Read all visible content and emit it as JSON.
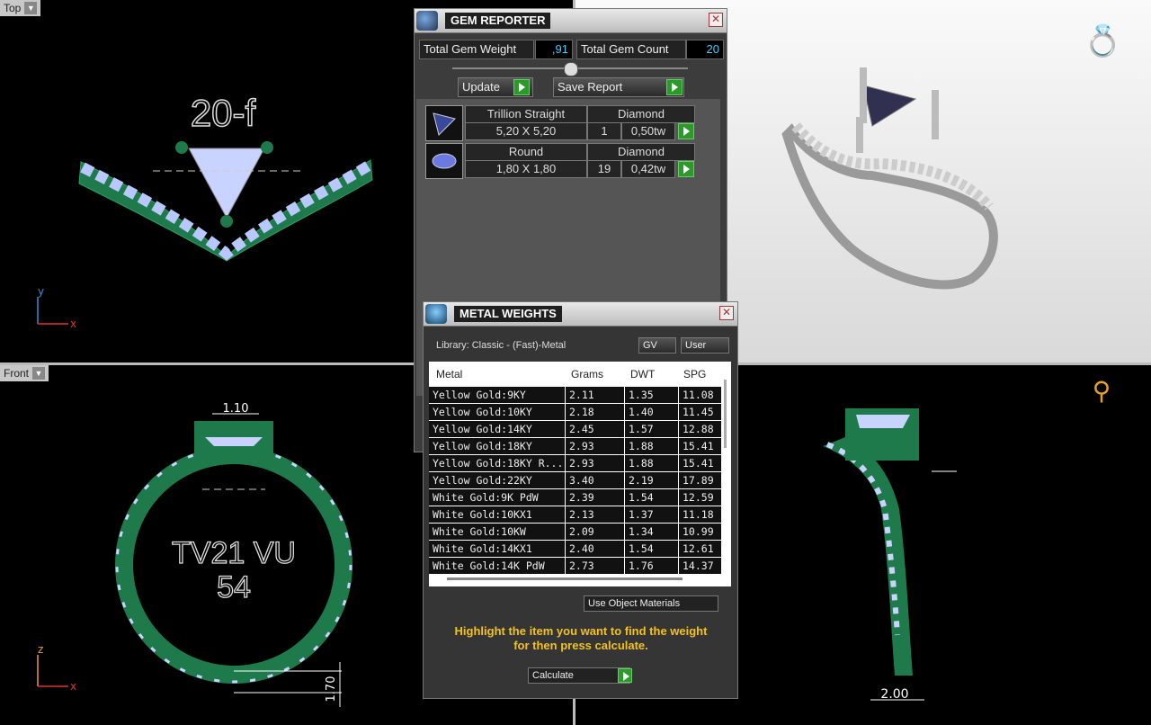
{
  "viewports": {
    "top_left": {
      "label": "Top",
      "model_text": "20-f",
      "axis_y": "y",
      "axis_x": "x"
    },
    "bottom_left": {
      "label": "Front",
      "model_text_line1": "TV21 VU",
      "model_text_line2": "54",
      "dim_top": "1.10",
      "dim_side": "1.70",
      "axis_z": "z",
      "axis_x": "x"
    },
    "bottom_right": {
      "dim_bottom": "2.00"
    }
  },
  "gem_reporter": {
    "title": "GEM REPORTER",
    "total_weight_label": "Total Gem Weight",
    "total_weight_value": ",91",
    "total_count_label": "Total Gem Count",
    "total_count_value": "20",
    "update_label": "Update",
    "save_report_label": "Save Report",
    "gems": [
      {
        "shape": "Trillion Straight",
        "material": "Diamond",
        "size": "5,20 X 5,20",
        "count": "1",
        "weight": "0,50tw"
      },
      {
        "shape": "Round",
        "material": "Diamond",
        "size": "1,80 X 1,80",
        "count": "19",
        "weight": "0,42tw"
      }
    ]
  },
  "metal_weights": {
    "title": "METAL WEIGHTS",
    "library": "Library: Classic - (Fast)-Metal",
    "gv_label": "GV",
    "user_label": "User",
    "columns": [
      "Metal",
      "Grams",
      "DWT",
      "SPG"
    ],
    "rows": [
      [
        "Yellow Gold:9KY",
        "2.11",
        "1.35",
        "11.08"
      ],
      [
        "Yellow Gold:10KY",
        "2.18",
        "1.40",
        "11.45"
      ],
      [
        "Yellow Gold:14KY",
        "2.45",
        "1.57",
        "12.88"
      ],
      [
        "Yellow Gold:18KY",
        "2.93",
        "1.88",
        "15.41"
      ],
      [
        "Yellow Gold:18KY R...",
        "2.93",
        "1.88",
        "15.41"
      ],
      [
        "Yellow Gold:22KY",
        "3.40",
        "2.19",
        "17.89"
      ],
      [
        "White Gold:9K PdW",
        "2.39",
        "1.54",
        "12.59"
      ],
      [
        "White Gold:10KX1",
        "2.13",
        "1.37",
        "11.18"
      ],
      [
        "White Gold:10KW",
        "2.09",
        "1.34",
        "10.99"
      ],
      [
        "White Gold:14KX1",
        "2.40",
        "1.54",
        "12.61"
      ],
      [
        "White Gold:14K PdW",
        "2.73",
        "1.76",
        "14.37"
      ]
    ],
    "use_object_materials_label": "Use Object Materials",
    "hint_line1": "Highlight the item you want to find the weight",
    "hint_line2": "for then press calculate.",
    "calculate_label": "Calculate"
  }
}
